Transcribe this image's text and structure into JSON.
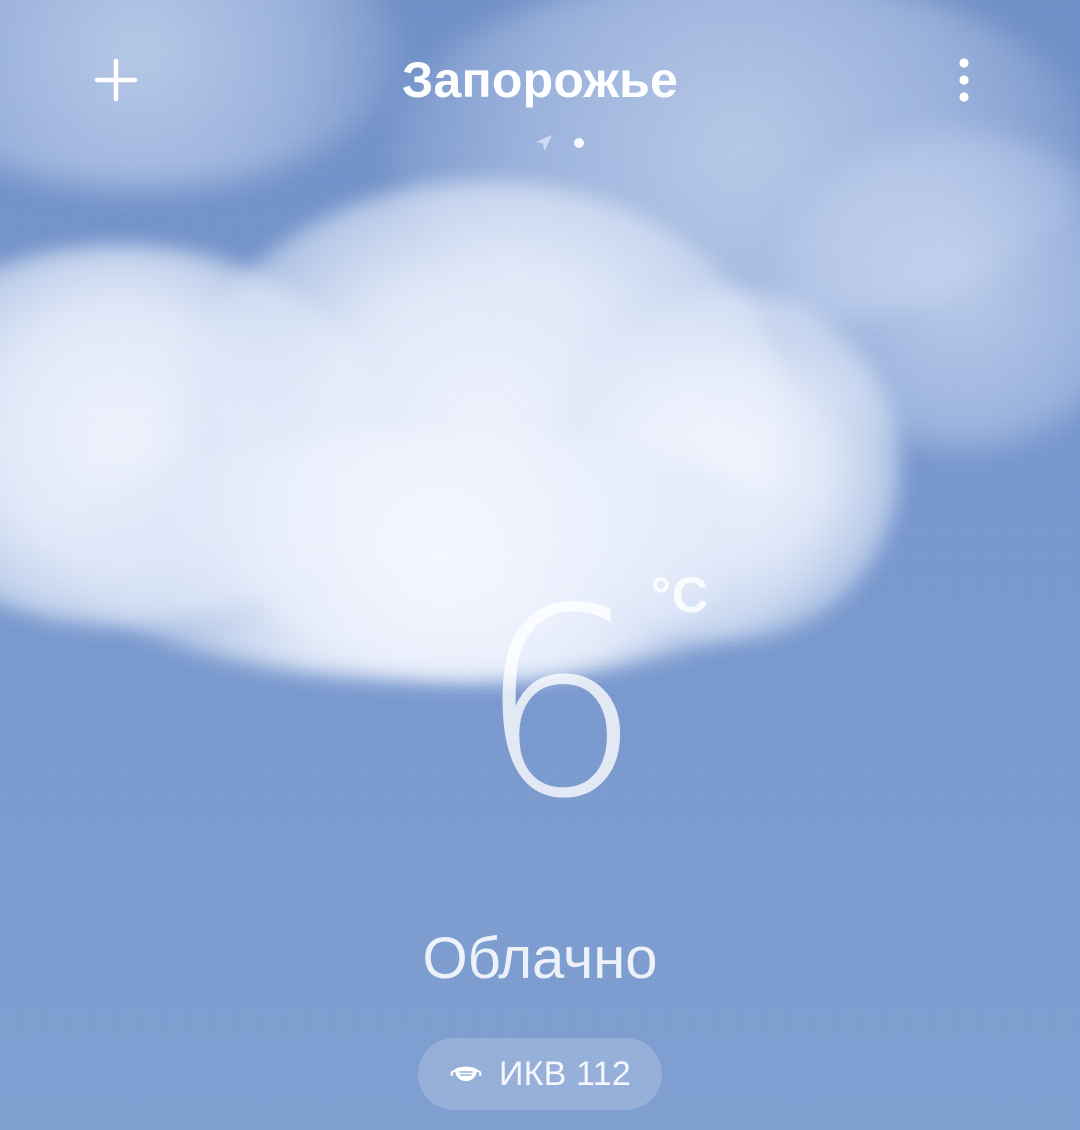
{
  "header": {
    "city": "Запорожье",
    "add_icon": "plus-icon",
    "more_icon": "more-vertical-icon",
    "location_icon": "location-arrow-icon",
    "pages": 1
  },
  "weather": {
    "temperature": "6",
    "unit": "°C",
    "condition": "Облачно",
    "aqi_label": "ИКВ 112",
    "aqi_icon": "mask-icon"
  },
  "colors": {
    "sky_top": "#6f8fc6",
    "sky_bottom": "#7f9fd1",
    "text": "#ffffff"
  }
}
